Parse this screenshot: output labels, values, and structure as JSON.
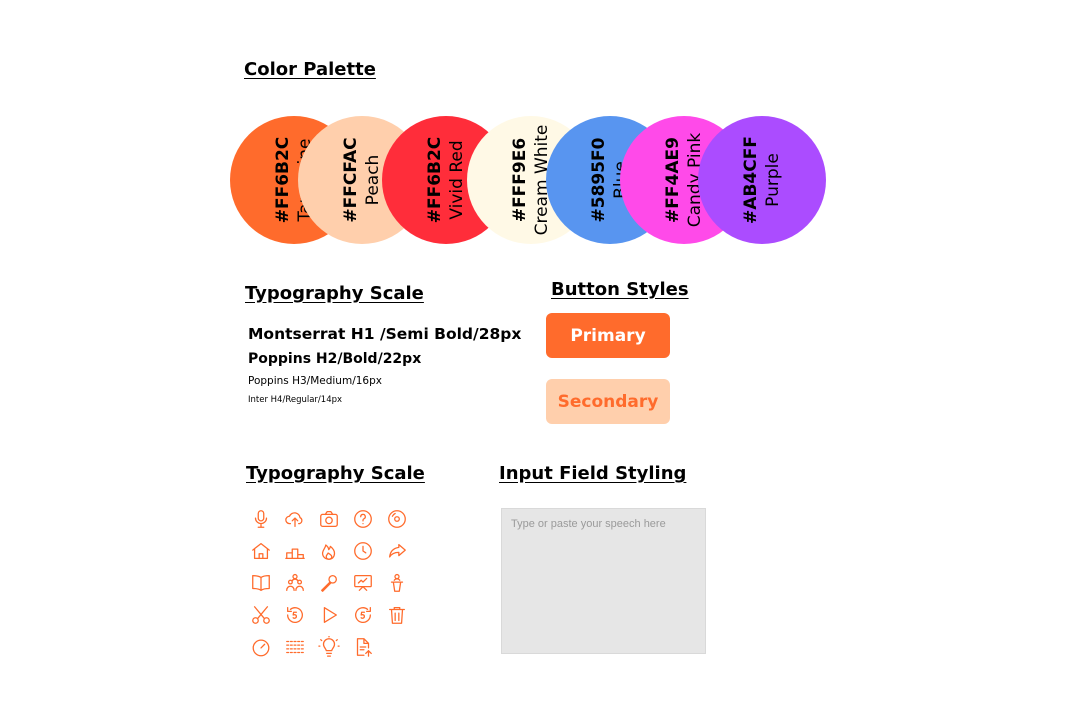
{
  "sections": {
    "palette_title": "Color Palette",
    "typography_title": "Typography Scale",
    "buttons_title": "Button Styles",
    "icons_title": "Typography Scale",
    "input_title": "Input Field Styling"
  },
  "palette": [
    {
      "hex": "#FF6B2C",
      "name": "Tangerine",
      "color": "#FF6B2C"
    },
    {
      "hex": "#FFCFAC",
      "name": "Peach",
      "color": "#FFCFAC"
    },
    {
      "hex": "#FF6B2C",
      "name": "Vivid Red",
      "color": "#FF2D3A"
    },
    {
      "hex": "#FFF9E6",
      "name": "Cream White",
      "color": "#FFF9E6"
    },
    {
      "hex": "#5895F0",
      "name": "Blue",
      "color": "#5895F0"
    },
    {
      "hex": "#FF4AE9",
      "name": "Candy Pink",
      "color": "#FF4AE9"
    },
    {
      "hex": "#AB4CFF",
      "name": "Purple",
      "color": "#AB4CFF"
    }
  ],
  "typography": [
    "Montserrat H1 /Semi Bold/28px",
    "Poppins H2/Bold/22px",
    "Poppins H3/Medium/16px",
    "Inter H4/Regular/14px"
  ],
  "buttons": {
    "primary_label": "Primary",
    "primary_bg": "#FF6B2C",
    "primary_text": "#FFFFFF",
    "secondary_label": "Secondary",
    "secondary_bg": "#FFCFAC",
    "secondary_text": "#FF6B2C"
  },
  "icons": [
    "microphone-icon",
    "cloud-upload-icon",
    "camera-icon",
    "help-icon",
    "disc-icon",
    "home-icon",
    "podium-icon",
    "fire-icon",
    "clock-icon",
    "share-icon",
    "book-icon",
    "group-icon",
    "karaoke-mic-icon",
    "presentation-icon",
    "speaker-podium-icon",
    "scissors-icon",
    "replay-5-icon",
    "play-icon",
    "forward-5-icon",
    "trash-icon",
    "gauge-icon",
    "keyboard-icon",
    "lightbulb-icon",
    "document-icon"
  ],
  "input": {
    "placeholder": "Type or paste your speech here"
  }
}
